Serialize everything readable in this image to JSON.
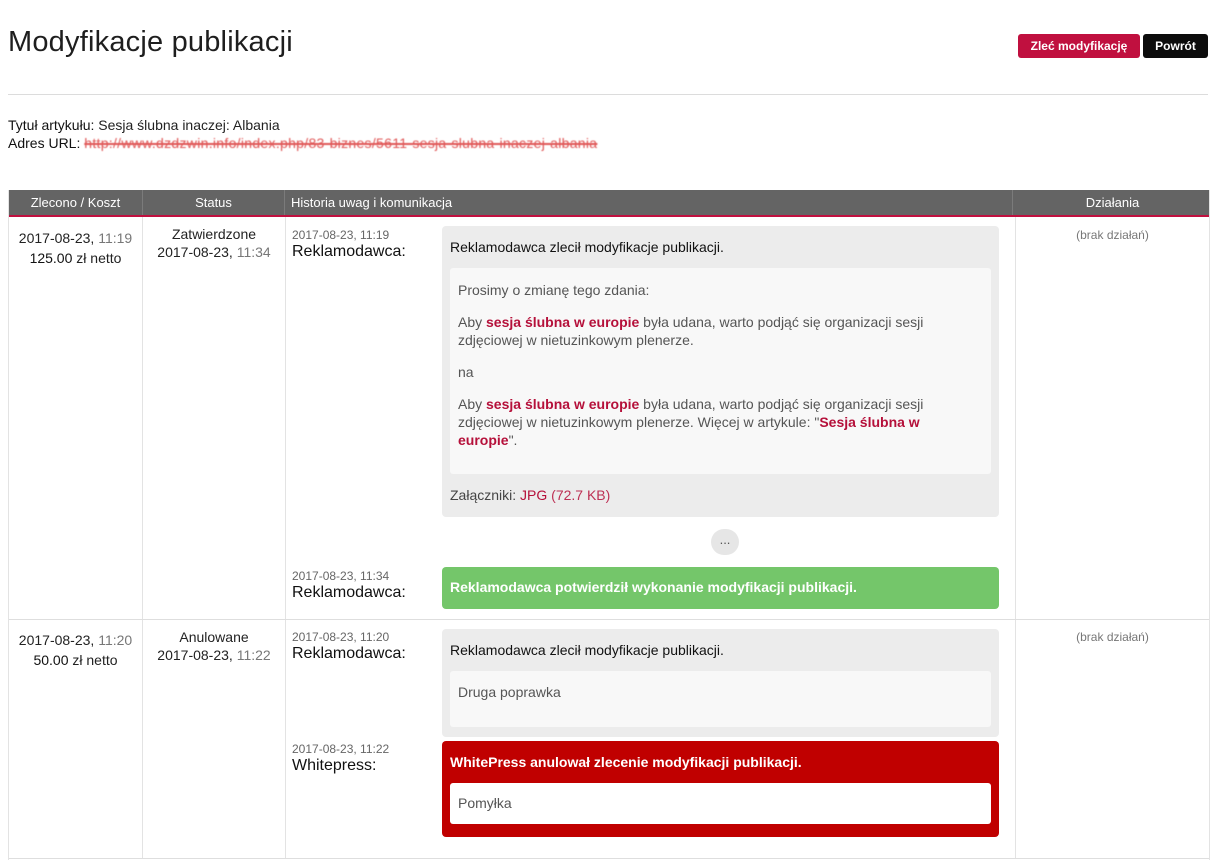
{
  "header": {
    "title": "Modyfikacje publikacji",
    "order_button": "Zleć modyfikację",
    "back_button": "Powrót"
  },
  "meta": {
    "title_label": "Tytuł artykułu:",
    "title_value": "Sesja ślubna inaczej: Albania",
    "url_label": "Adres URL:",
    "url_value": "http://www.dzdzwin.info/index.php/83-biznes/5611-sesja-slubna-inaczej-albania"
  },
  "table": {
    "columns": [
      "Zlecono / Koszt",
      "Status",
      "Historia uwag i komunikacja",
      "Działania"
    ]
  },
  "rows": [
    {
      "ordered_date": "2017-08-23,",
      "ordered_time": "11:19",
      "cost": "125.00",
      "cost_suffix": "zł netto",
      "status": "Zatwierdzone",
      "status_date": "2017-08-23,",
      "status_time": "11:34",
      "actions": "(brak działań)",
      "entries": [
        {
          "datetime": "2017-08-23, 11:19",
          "author": "Reklamodawca:",
          "head": "Reklamodawca zlecił modyfikacje publikacji.",
          "p1": "Prosimy o zmianę tego zdania:",
          "p2_pre": "Aby ",
          "p2_kw": "sesja ślubna w europie",
          "p2_post": " była udana, warto podjąć się organizacji sesji zdjęciowej w nietuzinkowym plenerze.",
          "p3": "na",
          "p4_pre": "Aby ",
          "p4_kw": "sesja ślubna w europie",
          "p4_mid": " była udana, warto podjąć się organizacji sesji zdjęciowej w nietuzinkowym plenerze. Więcej w artykule: \"",
          "p4_kw2": "Sesja ślubna w europie",
          "p4_post": "\".",
          "attach_label": "Załączniki:",
          "attach_file": "JPG",
          "attach_size": "(72.7 KB)"
        },
        {
          "datetime": "2017-08-23, 11:34",
          "author": "Reklamodawca:",
          "head": "Reklamodawca potwierdził wykonanie modyfikacji publikacji."
        }
      ],
      "more_label": "..."
    },
    {
      "ordered_date": "2017-08-23,",
      "ordered_time": "11:20",
      "cost": "50.00",
      "cost_suffix": "zł netto",
      "status": "Anulowane",
      "status_date": "2017-08-23,",
      "status_time": "11:22",
      "actions": "(brak działań)",
      "entries": [
        {
          "datetime": "2017-08-23, 11:20",
          "author": "Reklamodawca:",
          "head": "Reklamodawca zlecił modyfikacje publikacji.",
          "body": "Druga poprawka"
        },
        {
          "datetime": "2017-08-23, 11:22",
          "author": "Whitepress:",
          "head": "WhitePress anulował zlecenie modyfikacji publikacji.",
          "body": "Pomyłka"
        }
      ]
    }
  ],
  "colors": {
    "accent": "#c0103f",
    "header_bg": "#646464",
    "success": "#74c66a",
    "danger": "#c00000"
  }
}
